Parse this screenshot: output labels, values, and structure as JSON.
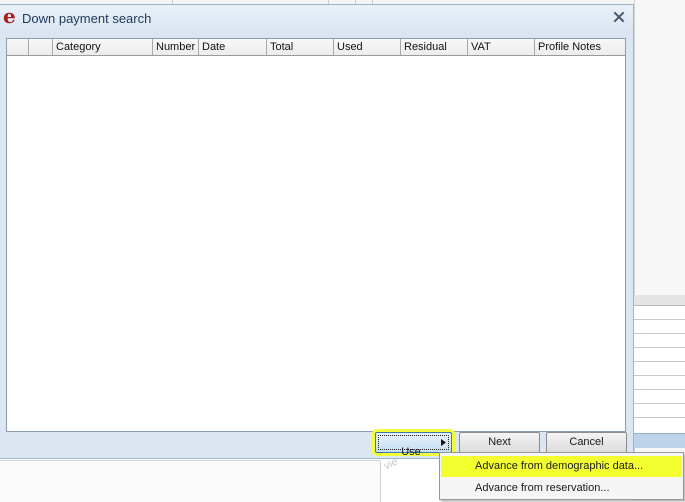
{
  "window": {
    "title": "Down payment search"
  },
  "grid": {
    "columns": [
      "",
      "",
      "Category",
      "Number",
      "Date",
      "Total",
      "Used",
      "Residual",
      "VAT",
      "Profile Notes"
    ],
    "rows": []
  },
  "buttons": {
    "use": "Use",
    "next": "Next",
    "cancel": "Cancel"
  },
  "use_menu": {
    "items": [
      "Advance from demographic data...",
      "Advance from reservation..."
    ]
  },
  "watermark_text": "vie",
  "colors": {
    "highlight": "#f2ff3c",
    "dialog_bg": "#dbe6f2",
    "logo": "#a3201c"
  }
}
